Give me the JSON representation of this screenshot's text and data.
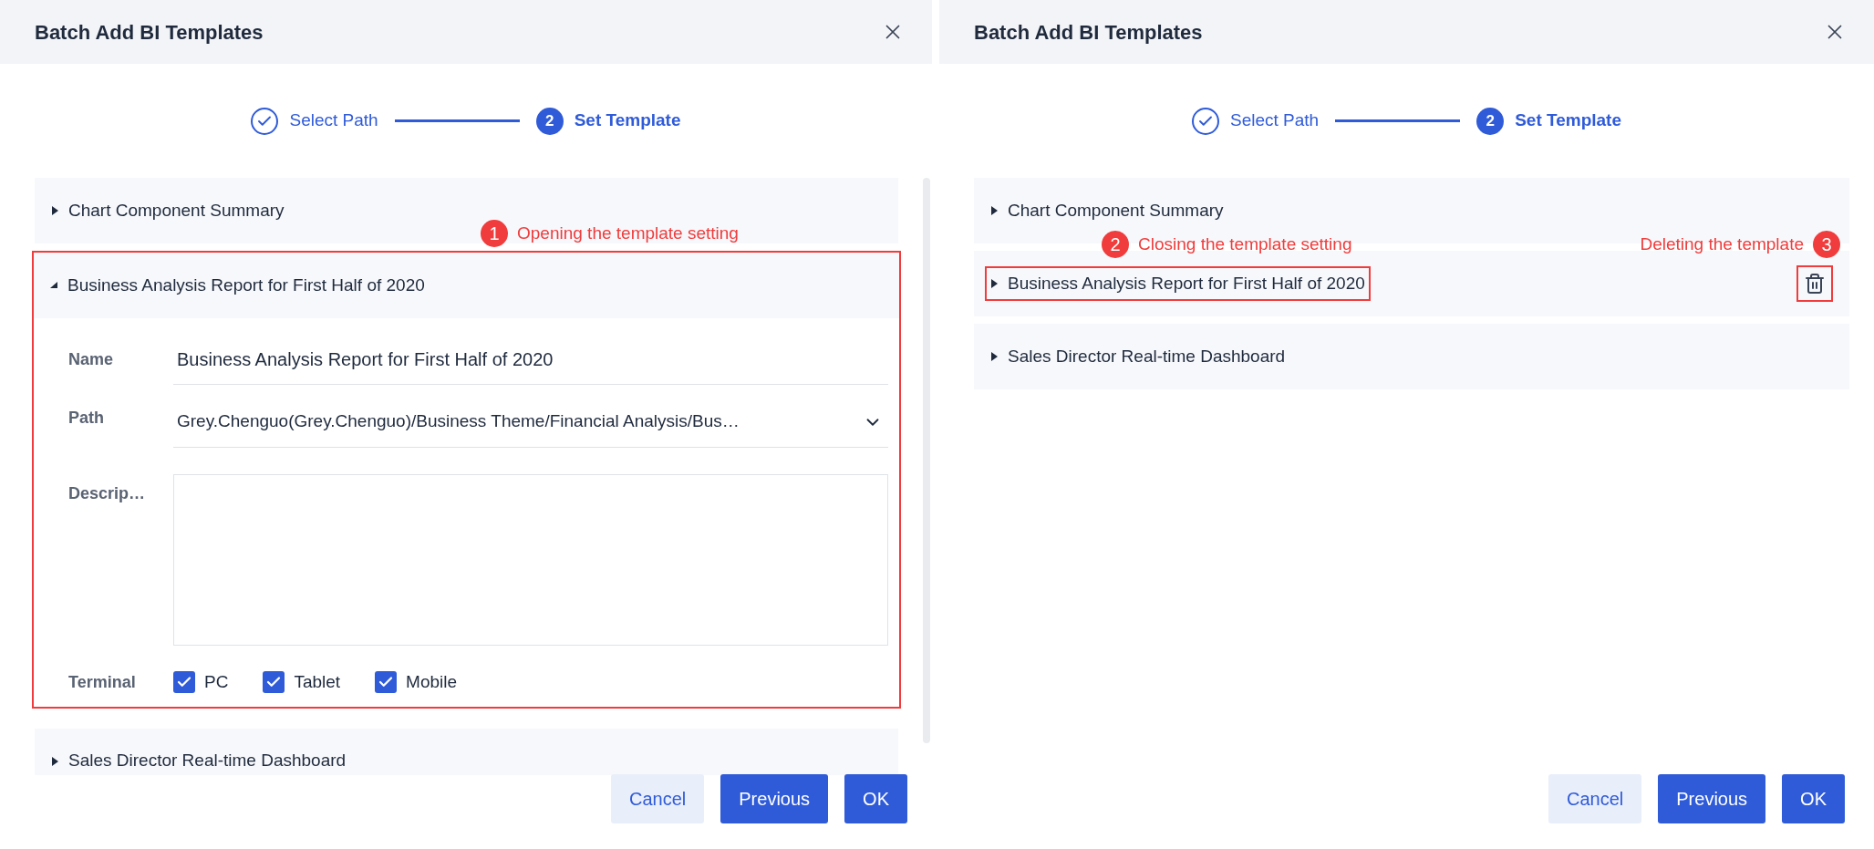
{
  "dialogs": [
    {
      "title": "Batch Add BI Templates",
      "steps": [
        {
          "label": "Select Path",
          "kind": "done"
        },
        {
          "label": "Set Template",
          "kind": "current",
          "number": "2"
        }
      ],
      "templates": [
        {
          "name": "Chart Component Summary",
          "expanded": false
        },
        {
          "name": "Business Analysis Report for First Half of 2020",
          "expanded": true,
          "highlighted": true,
          "note": {
            "number": "1",
            "text": "Opening the template setting"
          },
          "form": {
            "name_label": "Name",
            "name_value": "Business Analysis Report for First Half of 2020",
            "path_label": "Path",
            "path_value": "Grey.Chenguo(Grey.Chenguo)/Business Theme/Financial Analysis/Bus…",
            "description_label": "Descrip…",
            "terminal_label": "Terminal",
            "terminals": [
              {
                "label": "PC",
                "checked": true
              },
              {
                "label": "Tablet",
                "checked": true
              },
              {
                "label": "Mobile",
                "checked": true
              }
            ]
          }
        },
        {
          "name": "Sales Director Real-time Dashboard",
          "expanded": false
        }
      ],
      "buttons": [
        {
          "label": "Cancel",
          "kind": "secondary"
        },
        {
          "label": "Previous",
          "kind": "primary"
        },
        {
          "label": "OK",
          "kind": "primary"
        }
      ]
    },
    {
      "title": "Batch Add BI Templates",
      "steps": [
        {
          "label": "Select Path",
          "kind": "done"
        },
        {
          "label": "Set Template",
          "kind": "current",
          "number": "2"
        }
      ],
      "templates": [
        {
          "name": "Chart Component Summary",
          "expanded": false
        },
        {
          "name": "Business Analysis Report for First Half of 2020",
          "expanded": false,
          "highlighted": true,
          "note": {
            "number": "2",
            "text": "Closing the template setting"
          },
          "delete_button": {
            "highlighted": true,
            "note": {
              "number": "3",
              "text": "Deleting the template"
            }
          }
        },
        {
          "name": "Sales Director Real-time Dashboard",
          "expanded": false
        }
      ],
      "buttons": [
        {
          "label": "Cancel",
          "kind": "secondary"
        },
        {
          "label": "Previous",
          "kind": "primary"
        },
        {
          "label": "OK",
          "kind": "primary"
        }
      ]
    }
  ]
}
